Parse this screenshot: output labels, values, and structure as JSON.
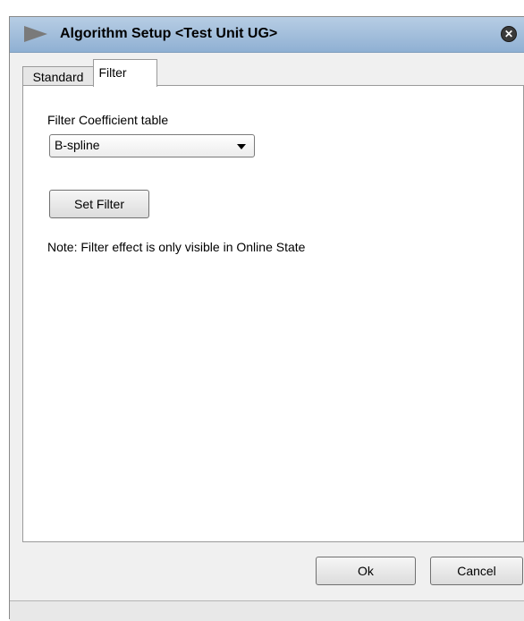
{
  "window": {
    "title": "Algorithm Setup <Test Unit UG>",
    "close_icon": "close-icon"
  },
  "tabs": [
    {
      "label": "Standard",
      "active": false
    },
    {
      "label": "Filter",
      "active": true
    }
  ],
  "filter_panel": {
    "coefficient_label": "Filter Coefficient table",
    "coefficient_select_value": "B-spline",
    "set_filter_label": "Set Filter",
    "note": "Note: Filter effect is only visible in Online State"
  },
  "footer": {
    "ok_label": "Ok",
    "cancel_label": "Cancel"
  },
  "colors": {
    "titlebar": "#9fbcdb",
    "panel_background": "#ffffff",
    "window_background": "#f0f0f0"
  }
}
